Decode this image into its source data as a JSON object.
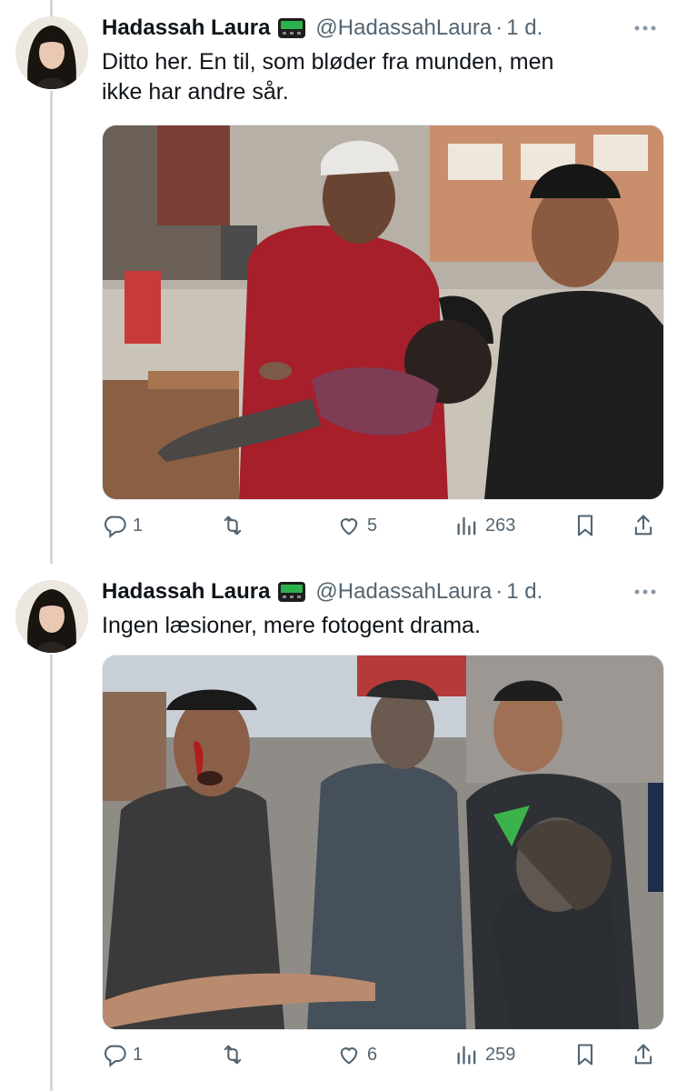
{
  "tweets": [
    {
      "author_name": "Hadassah Laura",
      "handle": "@HadassahLaura",
      "separator": "·",
      "time": "1 d.",
      "text_line1": "Ditto her. En til, som bløder fra munden, men",
      "text_line2": "ikke har andre sår.",
      "replies": "1",
      "likes": "5",
      "views": "263"
    },
    {
      "author_name": "Hadassah Laura",
      "handle": "@HadassahLaura",
      "separator": "·",
      "time": "1 d.",
      "text_line1": "Ingen læsioner, mere fotogent drama.",
      "replies": "1",
      "likes": "6",
      "views": "259"
    }
  ],
  "icons": {
    "reply": "reply-icon",
    "retweet": "retweet-icon",
    "like": "heart-icon",
    "views": "views-icon",
    "bookmark": "bookmark-icon",
    "share": "share-icon",
    "more": "more-icon",
    "badge": "pager-badge-icon"
  },
  "colors": {
    "text": "#0f1419",
    "secondary": "#536471",
    "thread_line": "#cfd9de",
    "badge_green": "#2bb24c"
  }
}
